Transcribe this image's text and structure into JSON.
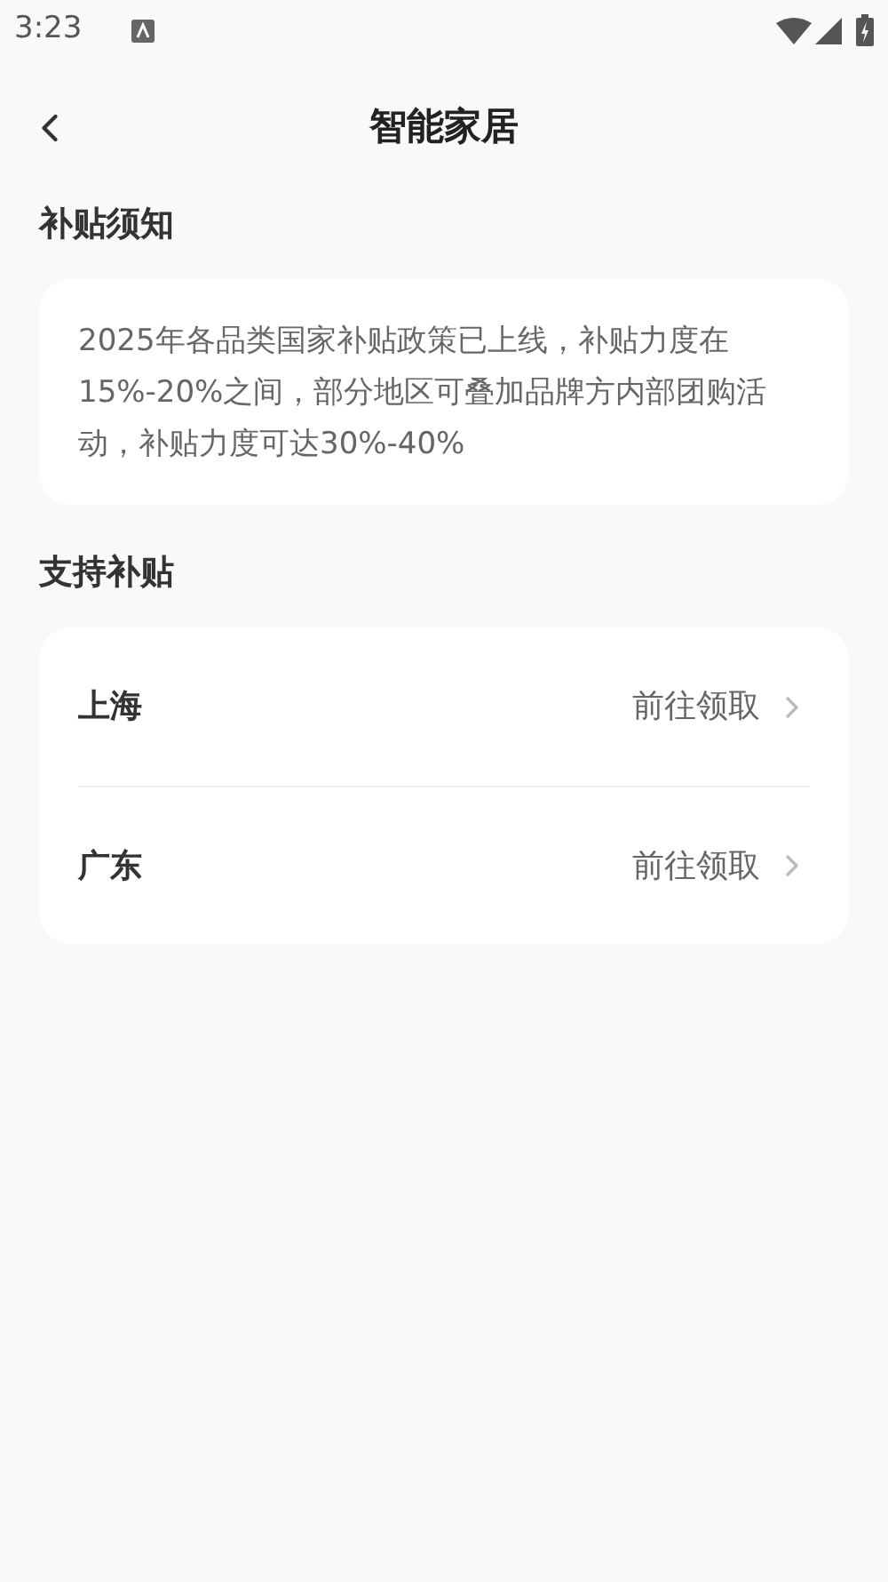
{
  "status_bar": {
    "time": "3:23"
  },
  "header": {
    "title": "智能家居"
  },
  "notice": {
    "heading": "补贴须知",
    "text": "2025年各品类国家补贴政策已上线，补贴力度在15%-20%之间，部分地区可叠加品牌方内部团购活动，补贴力度可达30%-40%"
  },
  "support": {
    "heading": "支持补贴",
    "items": [
      {
        "region": "上海",
        "action": "前往领取"
      },
      {
        "region": "广东",
        "action": "前往领取"
      }
    ]
  }
}
